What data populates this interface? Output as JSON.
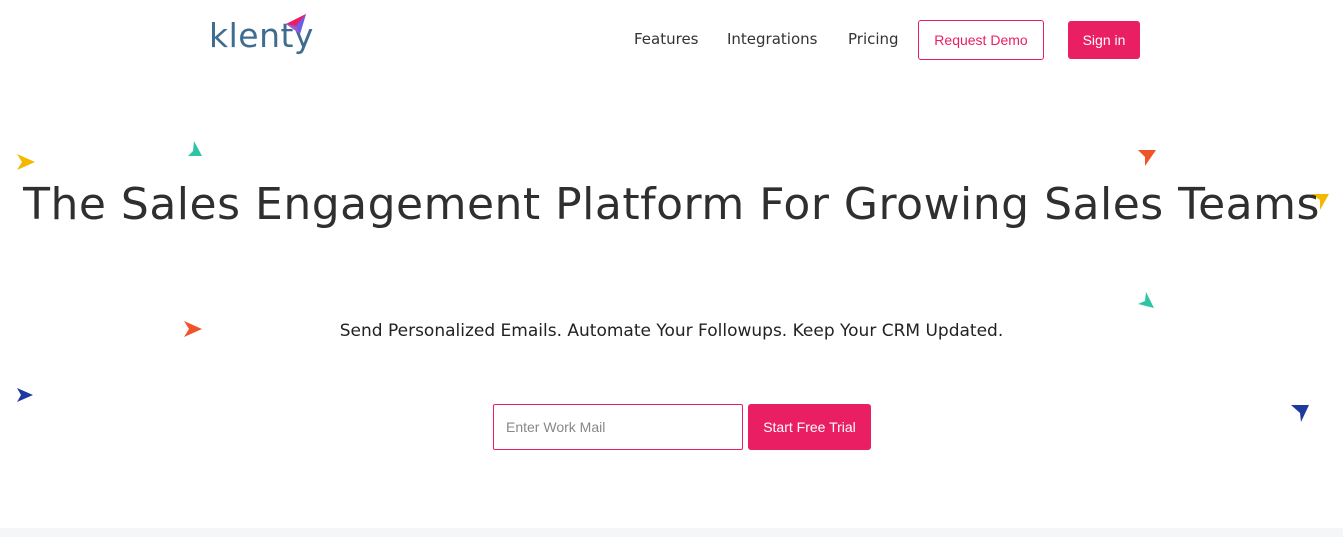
{
  "brand": {
    "name": "klenty"
  },
  "nav": {
    "features": "Features",
    "integrations": "Integrations",
    "pricing": "Pricing",
    "request_demo": "Request Demo",
    "sign_in": "Sign in"
  },
  "hero": {
    "title": "The Sales Engagement Platform For Growing Sales Teams",
    "subtitle": "Send Personalized Emails. Automate Your Followups. Keep Your CRM Updated."
  },
  "signup": {
    "email_placeholder": "Enter Work Mail",
    "email_value": "",
    "cta_label": "Start Free Trial"
  },
  "colors": {
    "accent": "#e91e63",
    "logo": "#3f6d8f",
    "yellow": "#f5b800",
    "teal": "#2ec4a6",
    "orange": "#f0522a",
    "navy": "#1f3a9e"
  },
  "icons": [
    "logo-paper-plane-icon",
    "paper-plane-icon"
  ]
}
